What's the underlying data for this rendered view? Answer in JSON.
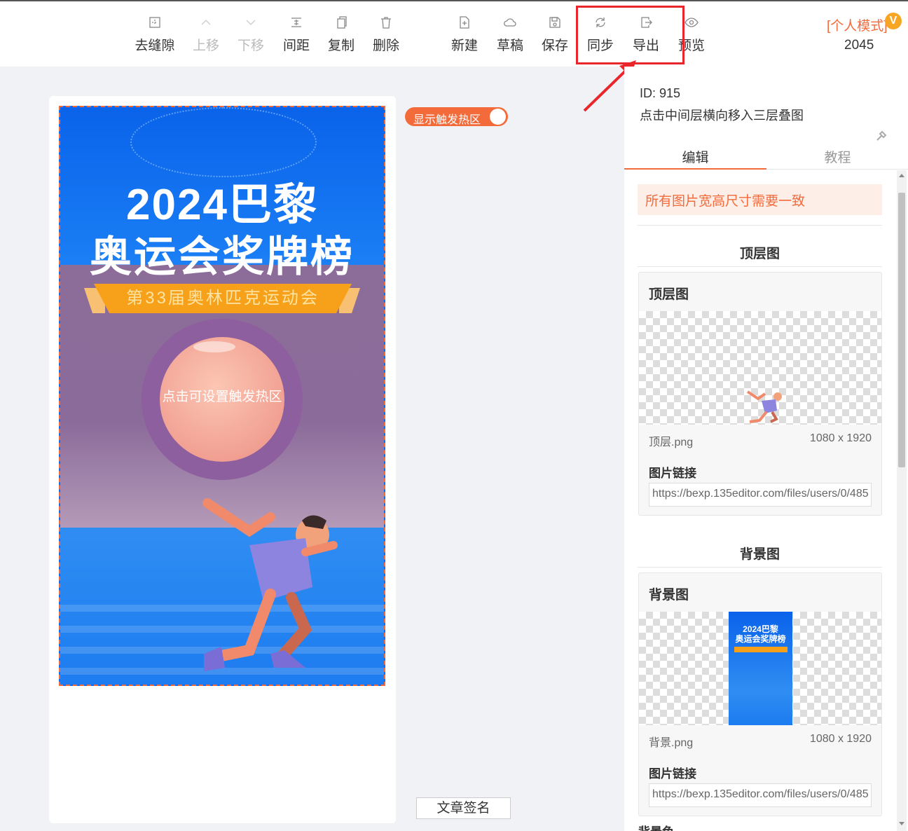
{
  "toolbar": {
    "items": [
      {
        "label": "去缝隙",
        "icon": "gap-icon",
        "disabled": false
      },
      {
        "label": "上移",
        "icon": "chevron-up-icon",
        "disabled": true
      },
      {
        "label": "下移",
        "icon": "chevron-down-icon",
        "disabled": true
      },
      {
        "label": "间距",
        "icon": "spacing-icon",
        "disabled": false
      },
      {
        "label": "复制",
        "icon": "copy-icon",
        "disabled": false
      },
      {
        "label": "删除",
        "icon": "trash-icon",
        "disabled": false
      },
      {
        "label": "新建",
        "icon": "new-file-icon",
        "disabled": false
      },
      {
        "label": "草稿",
        "icon": "cloud-icon",
        "disabled": false
      },
      {
        "label": "保存",
        "icon": "save-icon",
        "disabled": false
      },
      {
        "label": "同步",
        "icon": "sync-icon",
        "disabled": false
      },
      {
        "label": "导出",
        "icon": "export-icon",
        "disabled": false
      },
      {
        "label": "预览",
        "icon": "eye-icon",
        "disabled": false
      }
    ],
    "mode_label": "[个人模式]",
    "mode_badge": "V",
    "user_count": "2045"
  },
  "canvas": {
    "toggle_label": "显示触发热区",
    "toggle_on": true,
    "poster": {
      "title_line1": "2024巴黎",
      "title_line2": "奥运会奖牌榜",
      "ribbon_text": "第33届奥林匹克运动会",
      "hotspot_text": "点击可设置触发热区"
    },
    "signature_button": "文章签名"
  },
  "panel": {
    "id_line": "ID: 915",
    "name_line": "点击中间层横向移入三层叠图",
    "tabs": [
      "编辑",
      "教程"
    ],
    "active_tab": "编辑",
    "notice": "所有图片宽高尺寸需要一致",
    "sections": [
      {
        "heading": "顶层图",
        "card_title": "顶层图",
        "file_name": "顶层.png",
        "dims": "1080 x 1920",
        "link_label": "图片链接",
        "link_value": "https://bexp.135editor.com/files/users/0/485"
      },
      {
        "heading": "背景图",
        "card_title": "背景图",
        "file_name": "背景.png",
        "dims": "1080 x 1920",
        "link_label": "图片链接",
        "link_value": "https://bexp.135editor.com/files/users/0/485",
        "thumb_line1": "2024巴黎",
        "thumb_line2": "奥运会奖牌榜"
      }
    ],
    "next_heading_partial": "背景色"
  },
  "colors": {
    "accent": "#f36b3b",
    "highlight": "#e8262c",
    "notice_bg": "#fdeee8"
  }
}
